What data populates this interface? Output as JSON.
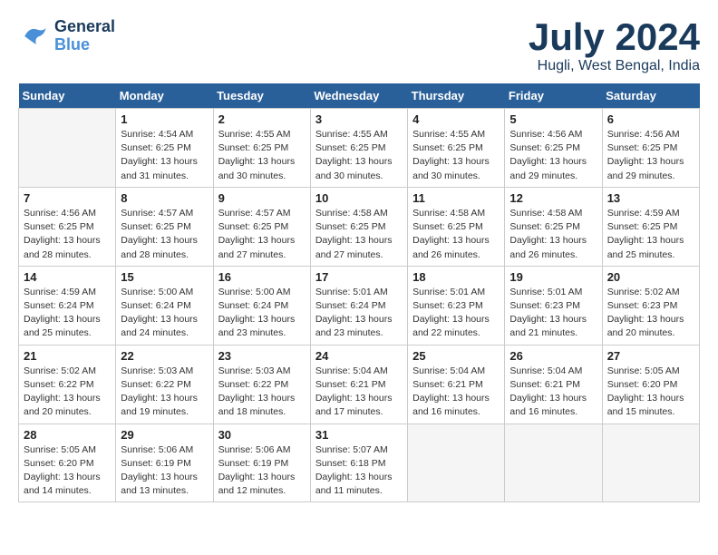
{
  "header": {
    "logo_line1": "General",
    "logo_line2": "Blue",
    "month_year": "July 2024",
    "location": "Hugli, West Bengal, India"
  },
  "weekdays": [
    "Sunday",
    "Monday",
    "Tuesday",
    "Wednesday",
    "Thursday",
    "Friday",
    "Saturday"
  ],
  "weeks": [
    [
      {
        "day": "",
        "info": ""
      },
      {
        "day": "1",
        "info": "Sunrise: 4:54 AM\nSunset: 6:25 PM\nDaylight: 13 hours\nand 31 minutes."
      },
      {
        "day": "2",
        "info": "Sunrise: 4:55 AM\nSunset: 6:25 PM\nDaylight: 13 hours\nand 30 minutes."
      },
      {
        "day": "3",
        "info": "Sunrise: 4:55 AM\nSunset: 6:25 PM\nDaylight: 13 hours\nand 30 minutes."
      },
      {
        "day": "4",
        "info": "Sunrise: 4:55 AM\nSunset: 6:25 PM\nDaylight: 13 hours\nand 30 minutes."
      },
      {
        "day": "5",
        "info": "Sunrise: 4:56 AM\nSunset: 6:25 PM\nDaylight: 13 hours\nand 29 minutes."
      },
      {
        "day": "6",
        "info": "Sunrise: 4:56 AM\nSunset: 6:25 PM\nDaylight: 13 hours\nand 29 minutes."
      }
    ],
    [
      {
        "day": "7",
        "info": "Sunrise: 4:56 AM\nSunset: 6:25 PM\nDaylight: 13 hours\nand 28 minutes."
      },
      {
        "day": "8",
        "info": "Sunrise: 4:57 AM\nSunset: 6:25 PM\nDaylight: 13 hours\nand 28 minutes."
      },
      {
        "day": "9",
        "info": "Sunrise: 4:57 AM\nSunset: 6:25 PM\nDaylight: 13 hours\nand 27 minutes."
      },
      {
        "day": "10",
        "info": "Sunrise: 4:58 AM\nSunset: 6:25 PM\nDaylight: 13 hours\nand 27 minutes."
      },
      {
        "day": "11",
        "info": "Sunrise: 4:58 AM\nSunset: 6:25 PM\nDaylight: 13 hours\nand 26 minutes."
      },
      {
        "day": "12",
        "info": "Sunrise: 4:58 AM\nSunset: 6:25 PM\nDaylight: 13 hours\nand 26 minutes."
      },
      {
        "day": "13",
        "info": "Sunrise: 4:59 AM\nSunset: 6:25 PM\nDaylight: 13 hours\nand 25 minutes."
      }
    ],
    [
      {
        "day": "14",
        "info": "Sunrise: 4:59 AM\nSunset: 6:24 PM\nDaylight: 13 hours\nand 25 minutes."
      },
      {
        "day": "15",
        "info": "Sunrise: 5:00 AM\nSunset: 6:24 PM\nDaylight: 13 hours\nand 24 minutes."
      },
      {
        "day": "16",
        "info": "Sunrise: 5:00 AM\nSunset: 6:24 PM\nDaylight: 13 hours\nand 23 minutes."
      },
      {
        "day": "17",
        "info": "Sunrise: 5:01 AM\nSunset: 6:24 PM\nDaylight: 13 hours\nand 23 minutes."
      },
      {
        "day": "18",
        "info": "Sunrise: 5:01 AM\nSunset: 6:23 PM\nDaylight: 13 hours\nand 22 minutes."
      },
      {
        "day": "19",
        "info": "Sunrise: 5:01 AM\nSunset: 6:23 PM\nDaylight: 13 hours\nand 21 minutes."
      },
      {
        "day": "20",
        "info": "Sunrise: 5:02 AM\nSunset: 6:23 PM\nDaylight: 13 hours\nand 20 minutes."
      }
    ],
    [
      {
        "day": "21",
        "info": "Sunrise: 5:02 AM\nSunset: 6:22 PM\nDaylight: 13 hours\nand 20 minutes."
      },
      {
        "day": "22",
        "info": "Sunrise: 5:03 AM\nSunset: 6:22 PM\nDaylight: 13 hours\nand 19 minutes."
      },
      {
        "day": "23",
        "info": "Sunrise: 5:03 AM\nSunset: 6:22 PM\nDaylight: 13 hours\nand 18 minutes."
      },
      {
        "day": "24",
        "info": "Sunrise: 5:04 AM\nSunset: 6:21 PM\nDaylight: 13 hours\nand 17 minutes."
      },
      {
        "day": "25",
        "info": "Sunrise: 5:04 AM\nSunset: 6:21 PM\nDaylight: 13 hours\nand 16 minutes."
      },
      {
        "day": "26",
        "info": "Sunrise: 5:04 AM\nSunset: 6:21 PM\nDaylight: 13 hours\nand 16 minutes."
      },
      {
        "day": "27",
        "info": "Sunrise: 5:05 AM\nSunset: 6:20 PM\nDaylight: 13 hours\nand 15 minutes."
      }
    ],
    [
      {
        "day": "28",
        "info": "Sunrise: 5:05 AM\nSunset: 6:20 PM\nDaylight: 13 hours\nand 14 minutes."
      },
      {
        "day": "29",
        "info": "Sunrise: 5:06 AM\nSunset: 6:19 PM\nDaylight: 13 hours\nand 13 minutes."
      },
      {
        "day": "30",
        "info": "Sunrise: 5:06 AM\nSunset: 6:19 PM\nDaylight: 13 hours\nand 12 minutes."
      },
      {
        "day": "31",
        "info": "Sunrise: 5:07 AM\nSunset: 6:18 PM\nDaylight: 13 hours\nand 11 minutes."
      },
      {
        "day": "",
        "info": ""
      },
      {
        "day": "",
        "info": ""
      },
      {
        "day": "",
        "info": ""
      }
    ]
  ]
}
